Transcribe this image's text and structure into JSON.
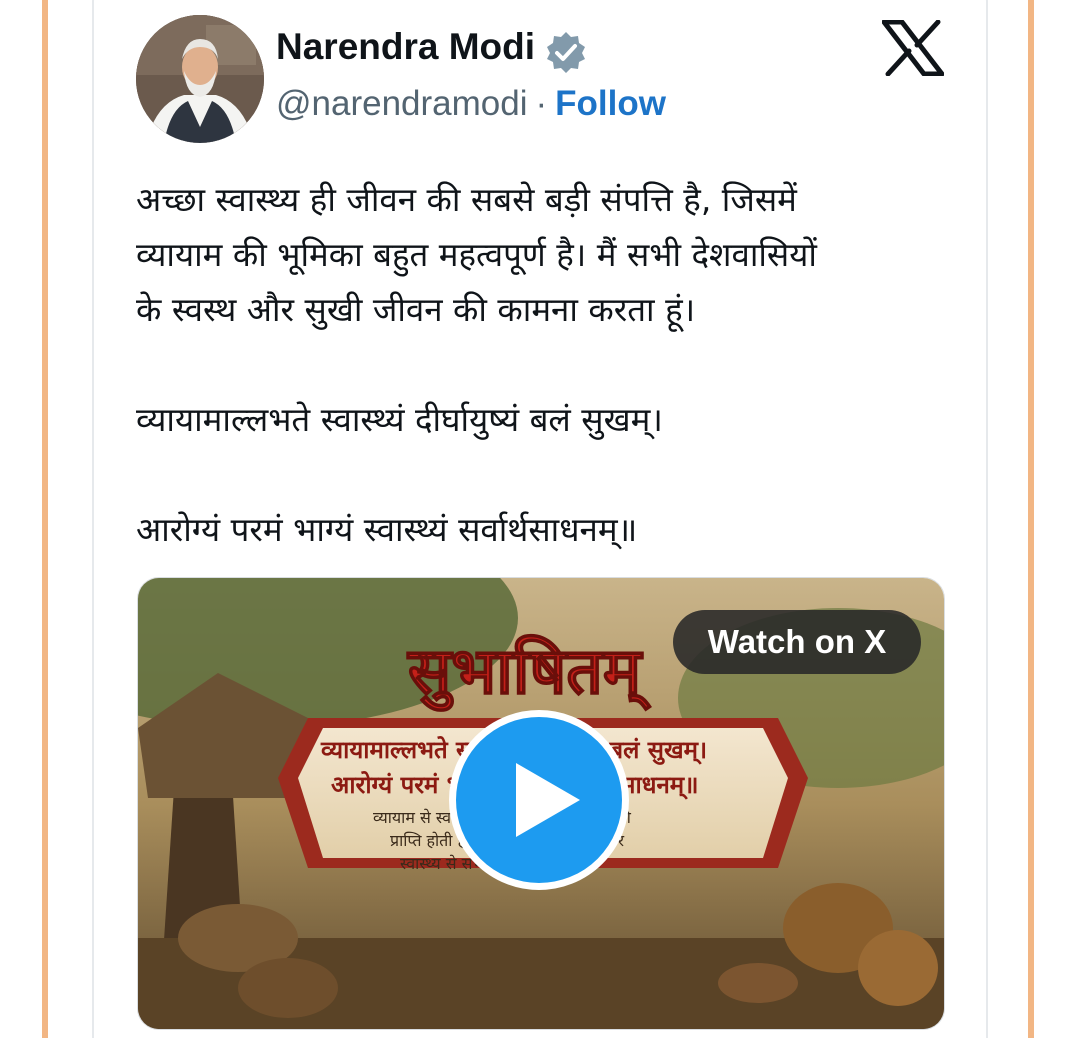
{
  "author": {
    "name": "Narendra Modi",
    "handle": "@narendramodi",
    "separator": "·",
    "follow_label": "Follow",
    "verified_color": "#829aab"
  },
  "tweet": {
    "lines": [
      "अच्छा स्वास्थ्य ही जीवन की सबसे बड़ी संपत्ति है, जिसमें",
      "व्यायाम की भूमिका बहुत महत्वपूर्ण है। मैं सभी देशवासियों",
      "के स्वस्थ और सुखी जीवन की कामना करता हूं।"
    ],
    "shloka_1": "व्यायामाल्लभते स्वास्थ्यं दीर्घायुष्यं बलं सुखम्।",
    "shloka_2": "आरोग्यं परमं भाग्यं स्वास्थ्यं सर्वार्थसाधनम्॥"
  },
  "media": {
    "watch_label": "Watch on X",
    "thumb_title": "सुभाषितम्",
    "thumb_line_1": "व्यायामाल्लभते स्वास्थ्यं दीर्घायुष्यं बलं सुखम्।",
    "thumb_line_2": "आरोग्यं परमं भाग्यं स्वास्थ्यं सर्वार्थसाधनम्॥",
    "thumb_small_1": "व्यायाम से स्वास्थ्य, दीर्घायु, बल और सुख की",
    "thumb_small_2": "प्राप्ति होती है। आरोग्य परम भाग्य है और",
    "thumb_small_3": "स्वास्थ्य से सभी कार्य सिद्ध होते हैं।",
    "play_color": "#1d9bf0"
  },
  "colors": {
    "follow": "#1d74c8",
    "side_border": "#f2b684"
  }
}
